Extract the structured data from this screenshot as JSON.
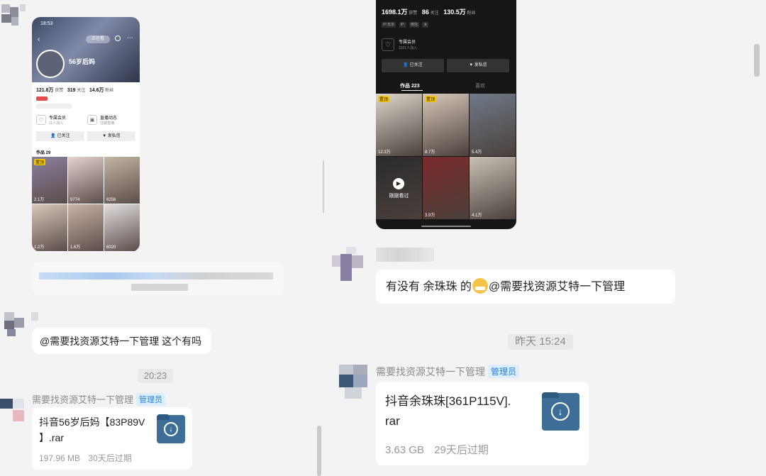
{
  "left": {
    "phone": {
      "status_time": "18:53",
      "chip": "正在看",
      "profile_name": "56岁后妈",
      "stats": [
        {
          "num": "121.8万",
          "label": "获赞"
        },
        {
          "num": "319",
          "label": "关注"
        },
        {
          "num": "14.6万",
          "label": "粉丝"
        }
      ],
      "member_label": "专属会员",
      "member_sub": "11人加入",
      "live_label": "直播动态",
      "live_sub": "往期直播",
      "follow_btn": "已关注",
      "msg_btn": "发私信",
      "works_tab": "作品 29",
      "tiles": [
        {
          "tag": "置顶",
          "count": "2.1万"
        },
        {
          "tag": "",
          "count": "9774"
        },
        {
          "tag": "",
          "count": "6256"
        },
        {
          "tag": "",
          "count": "1.2万"
        },
        {
          "tag": "",
          "count": "1.6万"
        },
        {
          "tag": "",
          "count": "6020"
        }
      ]
    },
    "msg2_text": "@需要找资源艾特一下管理 这个有吗",
    "time_sep": "20:23",
    "msg3_sender": "需要找资源艾特一下管理",
    "msg3_badge": "管理员",
    "file": {
      "name_line1": "抖音56岁后妈【83P89V",
      "name_line2": "】.rar",
      "size": "197.96 MB",
      "expiry": "30天后过期"
    }
  },
  "right": {
    "phone": {
      "stats": [
        {
          "num": "1698.1万",
          "label": "获赞"
        },
        {
          "num": "86",
          "label": "关注"
        },
        {
          "num": "130.5万",
          "label": "粉丝"
        }
      ],
      "tags": [
        "IP:日本",
        "IP:",
        "微信",
        "女"
      ],
      "member_label": "专属会员",
      "member_sub": "1621人加入",
      "follow_btn": "已关注",
      "msg_btn": "发私信",
      "works_tab": "作品 223",
      "likes_tab": "喜欢",
      "just_viewed": "刚刚看过",
      "tiles": [
        {
          "tag": "置顶",
          "count": "12.3万"
        },
        {
          "tag": "置顶",
          "count": "8.7万"
        },
        {
          "tag": "",
          "count": "5.4万"
        },
        {
          "tag": "",
          "count": ""
        },
        {
          "tag": "",
          "count": "3.9万"
        },
        {
          "tag": "",
          "count": "4.1万"
        }
      ]
    },
    "msg1_text_pre": "有没有 余珠珠 的",
    "msg1_text_post": "@需要找资源艾特一下管理",
    "time_sep": "昨天 15:24",
    "msg2_sender": "需要找资源艾特一下管理",
    "msg2_badge": "管理员",
    "file": {
      "name_line1": "抖音余珠珠[361P115V].",
      "name_line2": "rar",
      "size": "3.63 GB",
      "expiry": "29天后过期"
    }
  },
  "colors": {
    "background": "#f3f3f3",
    "bubble": "#ffffff",
    "admin_badge_bg": "#dbeeff",
    "admin_badge_text": "#2a7fd4",
    "file_icon": "#3c6e97"
  }
}
